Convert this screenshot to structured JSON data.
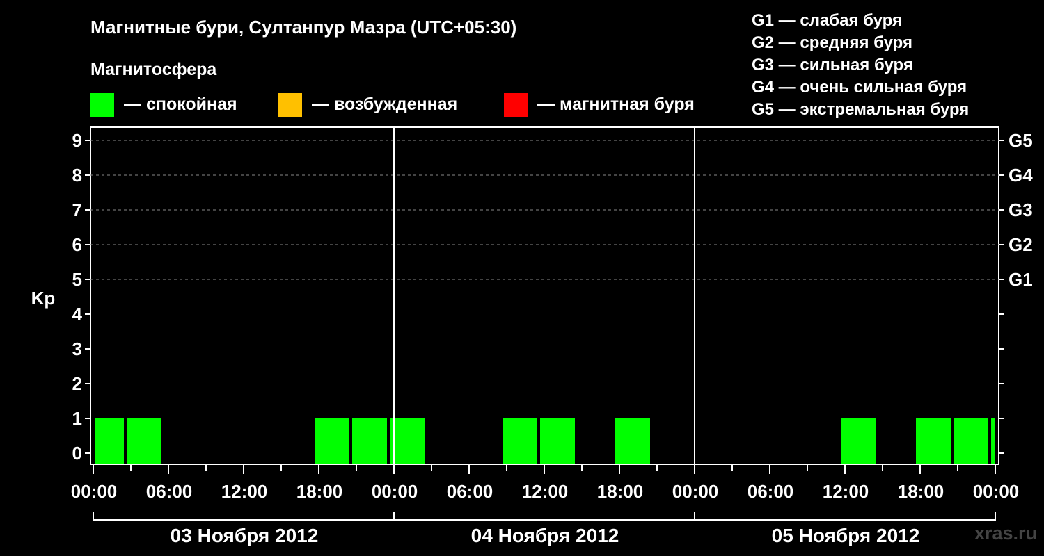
{
  "title": "Магнитные бури, Султанпур Мазра (UTC+05:30)",
  "subtitle": "Магнитосфера",
  "legend": [
    {
      "color": "#00ff00",
      "label": "— спокойная"
    },
    {
      "color": "#ffc000",
      "label": "— возбужденная"
    },
    {
      "color": "#ff0000",
      "label": "— магнитная буря"
    }
  ],
  "g_legend": [
    "G1 — слабая буря",
    "G2 — средняя буря",
    "G3 — сильная буря",
    "G4 — очень сильная буря",
    "G5 — экстремальная буря"
  ],
  "watermark": "xras.ru",
  "chart_data": {
    "type": "bar",
    "ylabel": "Kp",
    "ylim": [
      0,
      9
    ],
    "y_ticks": [
      "0",
      "1",
      "2",
      "3",
      "4",
      "5",
      "6",
      "7",
      "8",
      "9"
    ],
    "right_ticks": [
      {
        "kp": 5,
        "label": "G1"
      },
      {
        "kp": 6,
        "label": "G2"
      },
      {
        "kp": 7,
        "label": "G3"
      },
      {
        "kp": 8,
        "label": "G4"
      },
      {
        "kp": 9,
        "label": "G5"
      }
    ],
    "x_tick_labels": [
      "00:00",
      "06:00",
      "12:00",
      "18:00",
      "00:00",
      "06:00",
      "12:00",
      "18:00",
      "00:00",
      "06:00",
      "12:00",
      "18:00",
      "00:00"
    ],
    "days": [
      "03 Ноября 2012",
      "04 Ноября 2012",
      "05 Ноября 2012"
    ],
    "grid": "dashed horizontal at Kp 5–9",
    "bars": [
      {
        "start": "03 Ноября 2012 00:00",
        "end": "03 Ноября 2012 02:30",
        "kp": 1,
        "level": "спокойная"
      },
      {
        "start": "03 Ноября 2012 02:30",
        "end": "03 Ноября 2012 05:30",
        "kp": 1,
        "level": "спокойная"
      },
      {
        "start": "03 Ноября 2012 17:30",
        "end": "03 Ноября 2012 20:30",
        "kp": 1,
        "level": "спокойная"
      },
      {
        "start": "03 Ноября 2012 20:30",
        "end": "03 Ноября 2012 23:30",
        "kp": 1,
        "level": "спокойная"
      },
      {
        "start": "03 Ноября 2012 23:30",
        "end": "04 Ноября 2012 02:30",
        "kp": 1,
        "level": "спокойная"
      },
      {
        "start": "04 Ноября 2012 08:30",
        "end": "04 Ноября 2012 11:30",
        "kp": 1,
        "level": "спокойная"
      },
      {
        "start": "04 Ноября 2012 11:30",
        "end": "04 Ноября 2012 14:30",
        "kp": 1,
        "level": "спокойная"
      },
      {
        "start": "04 Ноября 2012 17:30",
        "end": "04 Ноября 2012 20:30",
        "kp": 1,
        "level": "спокойная"
      },
      {
        "start": "05 Ноября 2012 11:30",
        "end": "05 Ноября 2012 14:30",
        "kp": 1,
        "level": "спокойная"
      },
      {
        "start": "05 Ноября 2012 17:30",
        "end": "05 Ноября 2012 20:30",
        "kp": 1,
        "level": "спокойная"
      },
      {
        "start": "05 Ноября 2012 20:30",
        "end": "05 Ноября 2012 23:30",
        "kp": 1,
        "level": "спокойная"
      },
      {
        "start": "05 Ноября 2012 23:30",
        "end": "06 Ноября 2012 00:00",
        "kp": 1,
        "level": "спокойная"
      }
    ]
  }
}
